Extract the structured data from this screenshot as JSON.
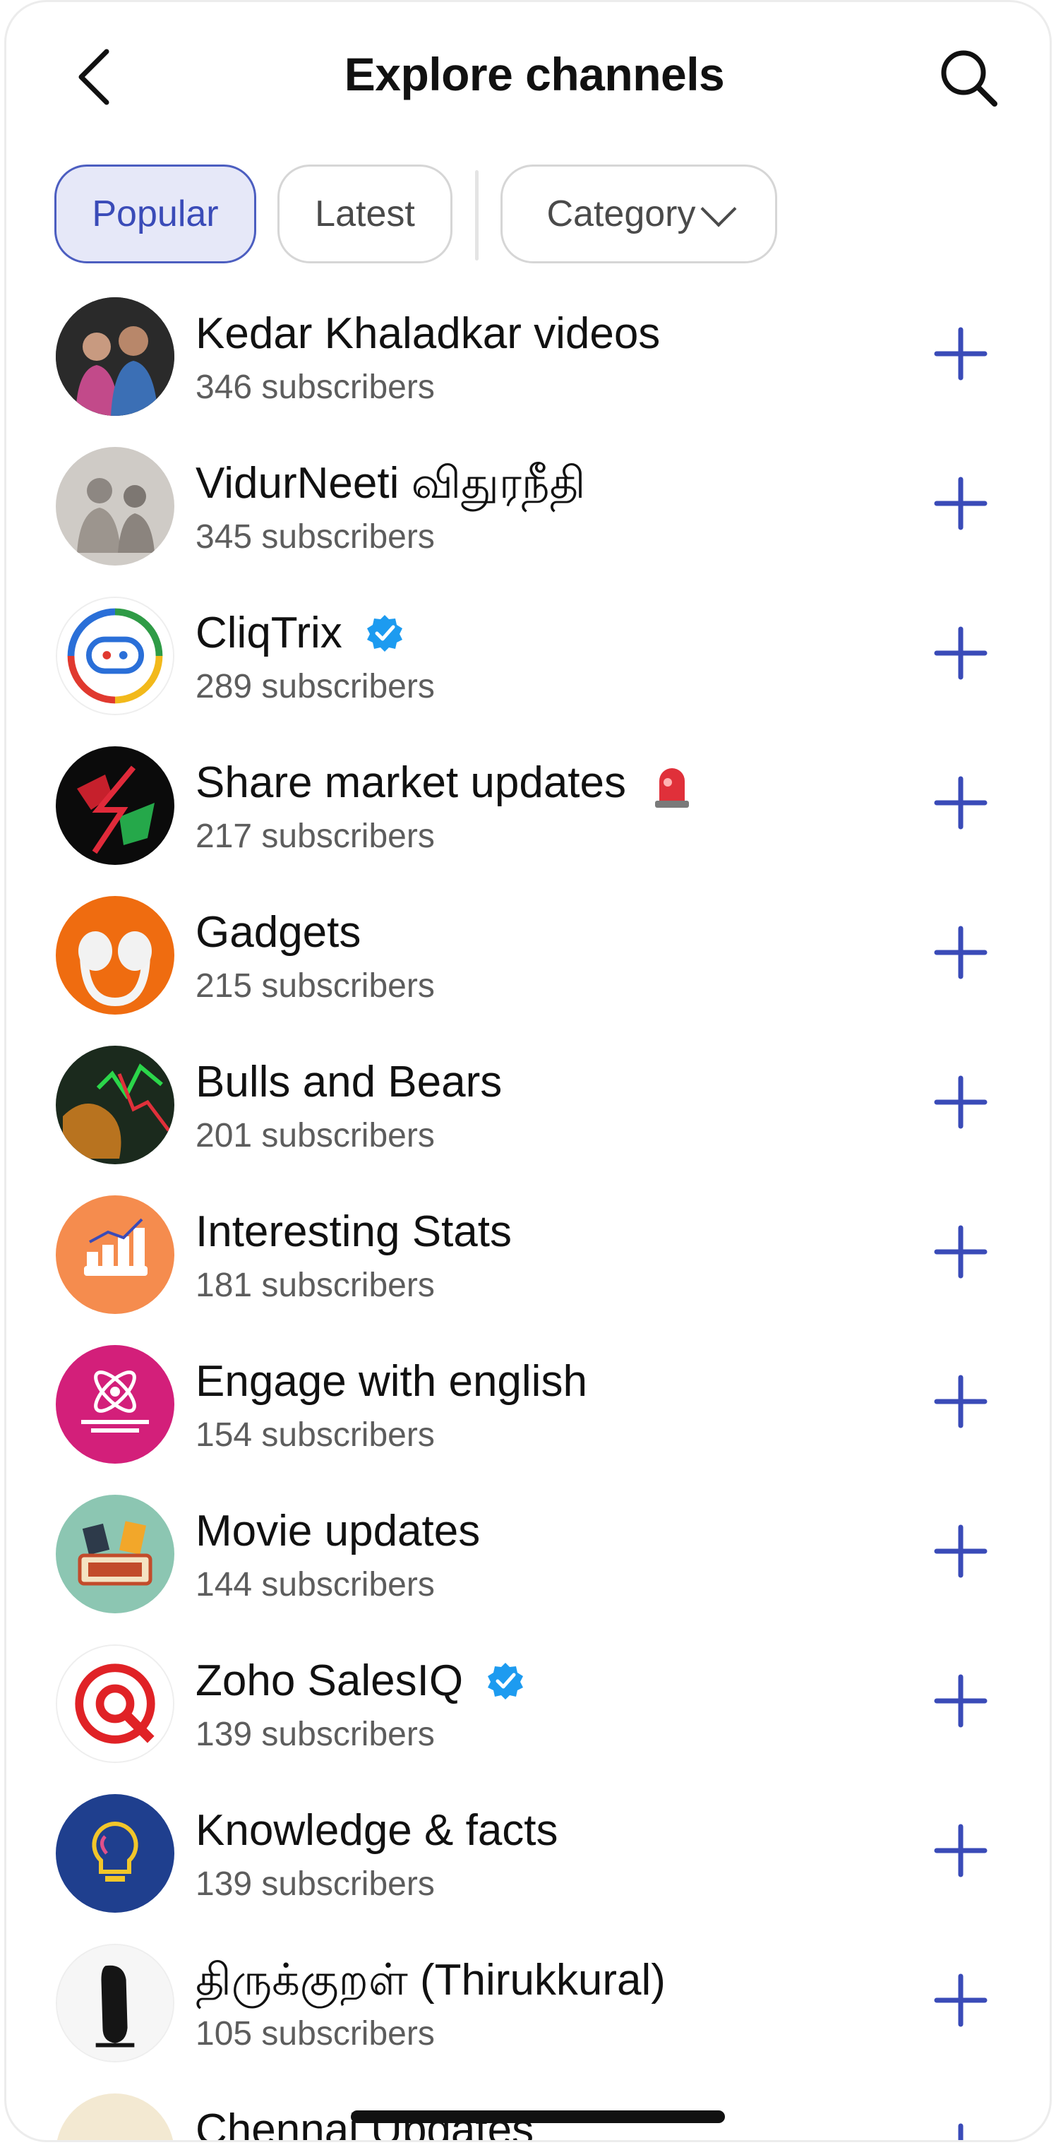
{
  "header": {
    "title": "Explore channels",
    "back_icon": "chevron-left-icon",
    "search_icon": "search-icon"
  },
  "filters": {
    "popular": "Popular",
    "latest": "Latest",
    "category": "Category"
  },
  "colors": {
    "accent": "#3a4bb8",
    "verified": "#1d9bf0",
    "chip_active_bg": "#e6e8f8"
  },
  "channels": [
    {
      "name": "Kedar Khaladkar videos",
      "subscribers": "346 subscribers"
    },
    {
      "name": "VidurNeeti விதுரநீதி",
      "subscribers": "345 subscribers"
    },
    {
      "name": "CliqTrix",
      "subscribers": "289 subscribers",
      "verified": true
    },
    {
      "name": "Share market updates",
      "subscribers": "217 subscribers",
      "emoji": "siren-icon"
    },
    {
      "name": "Gadgets",
      "subscribers": "215 subscribers"
    },
    {
      "name": "Bulls and Bears",
      "subscribers": "201 subscribers"
    },
    {
      "name": "Interesting Stats",
      "subscribers": "181 subscribers"
    },
    {
      "name": "Engage with english",
      "subscribers": "154 subscribers"
    },
    {
      "name": "Movie updates",
      "subscribers": "144 subscribers"
    },
    {
      "name": "Zoho SalesIQ",
      "subscribers": "139 subscribers",
      "verified": true
    },
    {
      "name": "Knowledge & facts",
      "subscribers": "139 subscribers"
    },
    {
      "name": "திருக்குறள் (Thirukkural)",
      "subscribers": "105 subscribers"
    },
    {
      "name": "Chennai Updates",
      "subscribers": ""
    }
  ]
}
